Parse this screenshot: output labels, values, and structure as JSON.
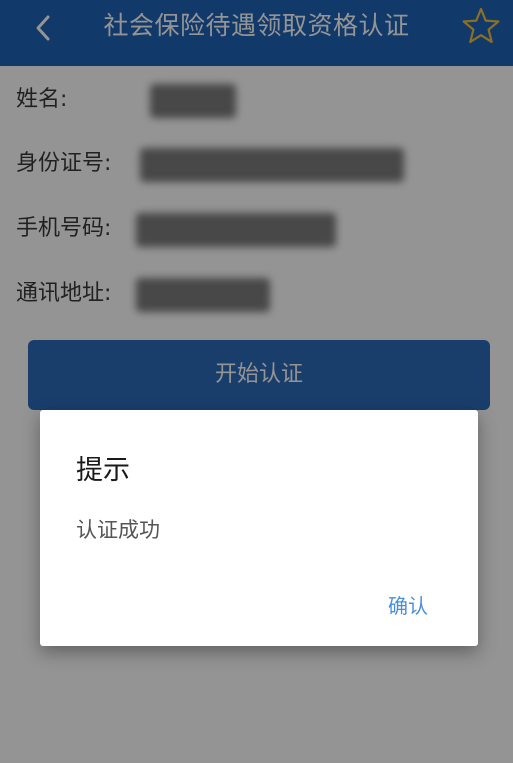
{
  "colors": {
    "header_bg": "#1e63b7",
    "primary_button": "#2e6bb8",
    "dialog_action": "#4a90d9"
  },
  "header": {
    "title": "社会保险待遇领取资格认证",
    "back_icon": "chevron-left-icon",
    "favorite_icon": "star-icon"
  },
  "form": {
    "rows": [
      {
        "label": "姓名:",
        "value": ""
      },
      {
        "label": "身份证号:",
        "value": ""
      },
      {
        "label": "手机号码:",
        "value": ""
      },
      {
        "label": "通讯地址:",
        "value": ""
      }
    ]
  },
  "start_button": {
    "label": "开始认证"
  },
  "dialog": {
    "title": "提示",
    "message": "认证成功",
    "confirm_label": "确认"
  }
}
